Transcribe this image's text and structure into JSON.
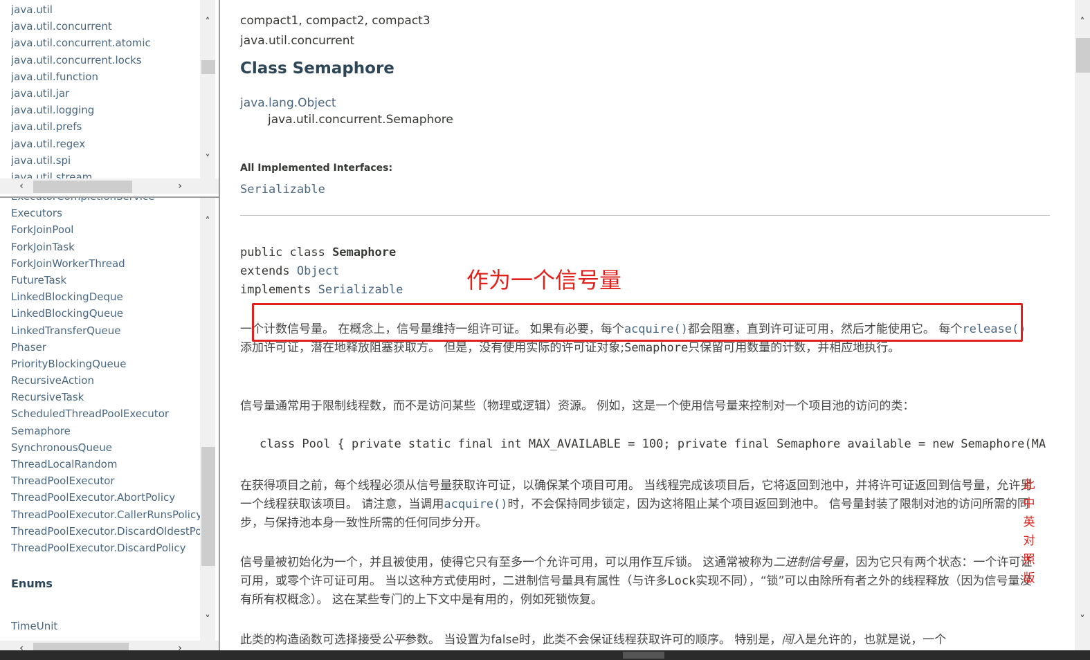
{
  "packages": [
    "java.util",
    "java.util.concurrent",
    "java.util.concurrent.atomic",
    "java.util.concurrent.locks",
    "java.util.function",
    "java.util.jar",
    "java.util.logging",
    "java.util.prefs",
    "java.util.regex",
    "java.util.spi",
    "java.util.stream"
  ],
  "classes": [
    "ExecutorCompletionService",
    "Executors",
    "ForkJoinPool",
    "ForkJoinTask",
    "ForkJoinWorkerThread",
    "FutureTask",
    "LinkedBlockingDeque",
    "LinkedBlockingQueue",
    "LinkedTransferQueue",
    "Phaser",
    "PriorityBlockingQueue",
    "RecursiveAction",
    "RecursiveTask",
    "ScheduledThreadPoolExecutor",
    "Semaphore",
    "SynchronousQueue",
    "ThreadLocalRandom",
    "ThreadPoolExecutor",
    "ThreadPoolExecutor.AbortPolicy",
    "ThreadPoolExecutor.CallerRunsPolicy",
    "ThreadPoolExecutor.DiscardOldestPolicy",
    "ThreadPoolExecutor.DiscardPolicy"
  ],
  "enums_heading": "Enums",
  "enum_item": "TimeUnit",
  "main": {
    "profiles": "compact1, compact2, compact3",
    "package": "java.util.concurrent",
    "title": "Class Semaphore",
    "inherit_parent": "java.lang.Object",
    "inherit_child": "java.util.concurrent.Semaphore",
    "impl_label": "All Implemented Interfaces:",
    "impl_link": "Serializable",
    "sig_kw1": "public class ",
    "sig_name": "Semaphore",
    "sig_kw2": "extends ",
    "sig_parent": "Object",
    "sig_kw3": "implements ",
    "sig_iface": "Serializable",
    "annotation": "作为一个信号量",
    "p1_a": "一个计数信号量。 在概念上，信号量维持一组许可证。 如果有必要，每个",
    "p1_code1": "acquire()",
    "p1_b": "都会阻塞，直到许可证可用，然后才能使用它。 每个",
    "p1_code2": "release()",
    "p1_c": "添加许可证，潜在地释放阻塞获取方。 但是，没有使用实际的许可证对象;",
    "p1_mono": "Semaphore",
    "p1_d": "只保留可用数量的计数，并相应地执行。",
    "p2": "信号量通常用于限制线程数，而不是访问某些（物理或逻辑）资源。 例如，这是一个使用信号量来控制对一个项目池的访问的类：",
    "code": "class Pool { private static final int MAX_AVAILABLE = 100; private final Semaphore available = new Semaphore(MA",
    "p3_a": "在获得项目之前，每个线程必须从信号量获取许可证，以确保某个项目可用。 当线程完成该项目后，它将返回到池中，并将许可证返回到信号量，允许另一个线程获取该项目。 请注意，当调用",
    "p3_code": "acquire()",
    "p3_b": "时，不会保持同步锁定，因为这将阻止某个项目返回到池中。 信号量封装了限制对池的访问所需的同步，与保持池本身一致性所需的任何同步分开。",
    "p4_a": "信号量被初始化为一个，并且被使用，使得它只有至多一个允许可用，可以用作互斥锁。 这通常被称为",
    "p4_em": "二进制信号量",
    "p4_b": "，因为它只有两个状态：一个许可证可用，或零个许可证可用。 当以这种方式使用时，二进制信号量具有属性（与许多",
    "p4_mono": "Lock",
    "p4_c": "实现不同），“锁”可以由除所有者之外的线程释放（因为信号量没有所有权概念）。 这在某些专门的上下文中是有用的，例如死锁恢复。",
    "p5_a": "此类的构造函数可选择接受",
    "p5_em1": "公平",
    "p5_b": "参数。 当设置为false时，此类不会保证线程获取许可的顺序。 特别是，",
    "p5_em2": "闯入",
    "p5_c": "是允许的，也就是说，一个",
    "vertical_note": [
      "此",
      "中",
      "英",
      "对",
      "照",
      "版"
    ]
  },
  "colors": {
    "link": "#4a6782",
    "title": "#2c4557",
    "annotation_red": "#e0201b"
  }
}
